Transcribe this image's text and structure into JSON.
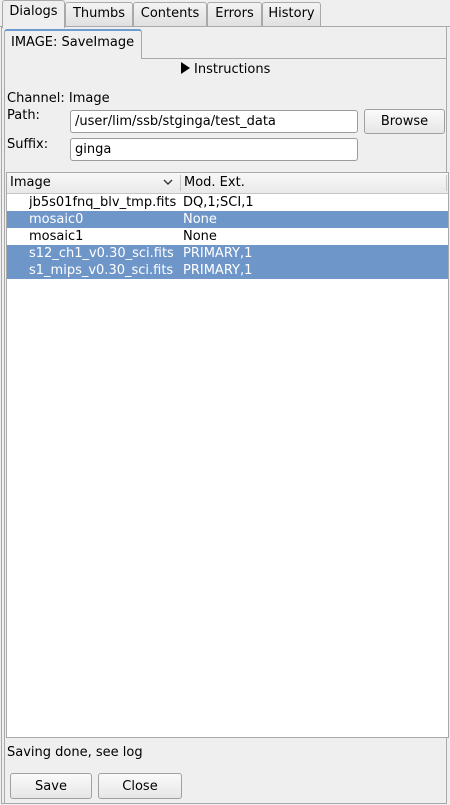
{
  "tabs": [
    {
      "label": "Dialogs",
      "active": true
    },
    {
      "label": "Thumbs",
      "active": false
    },
    {
      "label": "Contents",
      "active": false
    },
    {
      "label": "Errors",
      "active": false
    },
    {
      "label": "History",
      "active": false
    }
  ],
  "plugin_tab": {
    "label": "IMAGE: SaveImage"
  },
  "instructions": {
    "label": "Instructions"
  },
  "channel": {
    "label": "Channel: Image"
  },
  "path": {
    "label": "Path:",
    "value": "/user/lim/ssb/stginga/test_data"
  },
  "browse_label": "Browse",
  "suffix": {
    "label": "Suffix:",
    "value": "ginga"
  },
  "table": {
    "columns": [
      "Image",
      "Mod. Ext."
    ],
    "rows": [
      {
        "image": "jb5s01fnq_blv_tmp.fits",
        "ext": "DQ,1;SCI,1",
        "selected": false
      },
      {
        "image": "mosaic0",
        "ext": "None",
        "selected": true
      },
      {
        "image": "mosaic1",
        "ext": "None",
        "selected": false
      },
      {
        "image": "s12_ch1_v0.30_sci.fits",
        "ext": "PRIMARY,1",
        "selected": true
      },
      {
        "image": "s1_mips_v0.30_sci.fits",
        "ext": "PRIMARY,1",
        "selected": true
      }
    ]
  },
  "status_text": "Saving done, see log",
  "buttons": {
    "save": "Save",
    "close": "Close"
  },
  "colors": {
    "selection": "#6f96c9",
    "accent": "#6f9bd0"
  }
}
